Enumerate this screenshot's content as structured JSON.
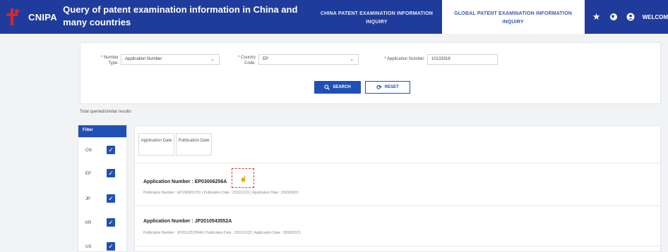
{
  "header": {
    "logo": "CNIPA",
    "title": "Query of patent examination information in China and many countries",
    "tabs": [
      {
        "label": "CHINA PATENT EXAMINATION INFORMATION INQUIRY",
        "active": false
      },
      {
        "label": "GLOBAL PATENT EXAMINATION INFORMATION INQUIRY",
        "active": true
      }
    ],
    "welcome": "WELCOM"
  },
  "search": {
    "number_type_label": "* Number Type:",
    "number_type_value": "Application Number",
    "country_label": "* Country Code:",
    "country_value": "EP",
    "app_number_label": "* Application Number:",
    "app_number_value": "10133318",
    "search_button": "SEARCH",
    "reset_button": "RESET"
  },
  "total_results": "Total queried/similar results",
  "filter": {
    "title": "Filter",
    "items": [
      "CN",
      "EP",
      "JP",
      "KR",
      "US"
    ]
  },
  "sort": {
    "application_date": "Application Date",
    "publication_date": "Publication Date"
  },
  "results": [
    {
      "title": "Application Number : EP03006256A",
      "meta": "Publication Number : EP1389013 B1 | Publication Date : 2011/12/21 | Application Date : 2003/03/21"
    },
    {
      "title": "Application Number : JP2010543552A",
      "meta": "Publication Number : JP2011257054A | Publication Date : 2011/12/22 | Application Date : 2009/02/21"
    }
  ],
  "colors": {
    "header_bg": "#1f3c9c",
    "accent": "#2150b4",
    "logo_red": "#d9262b",
    "highlight": "#e03b3b"
  }
}
